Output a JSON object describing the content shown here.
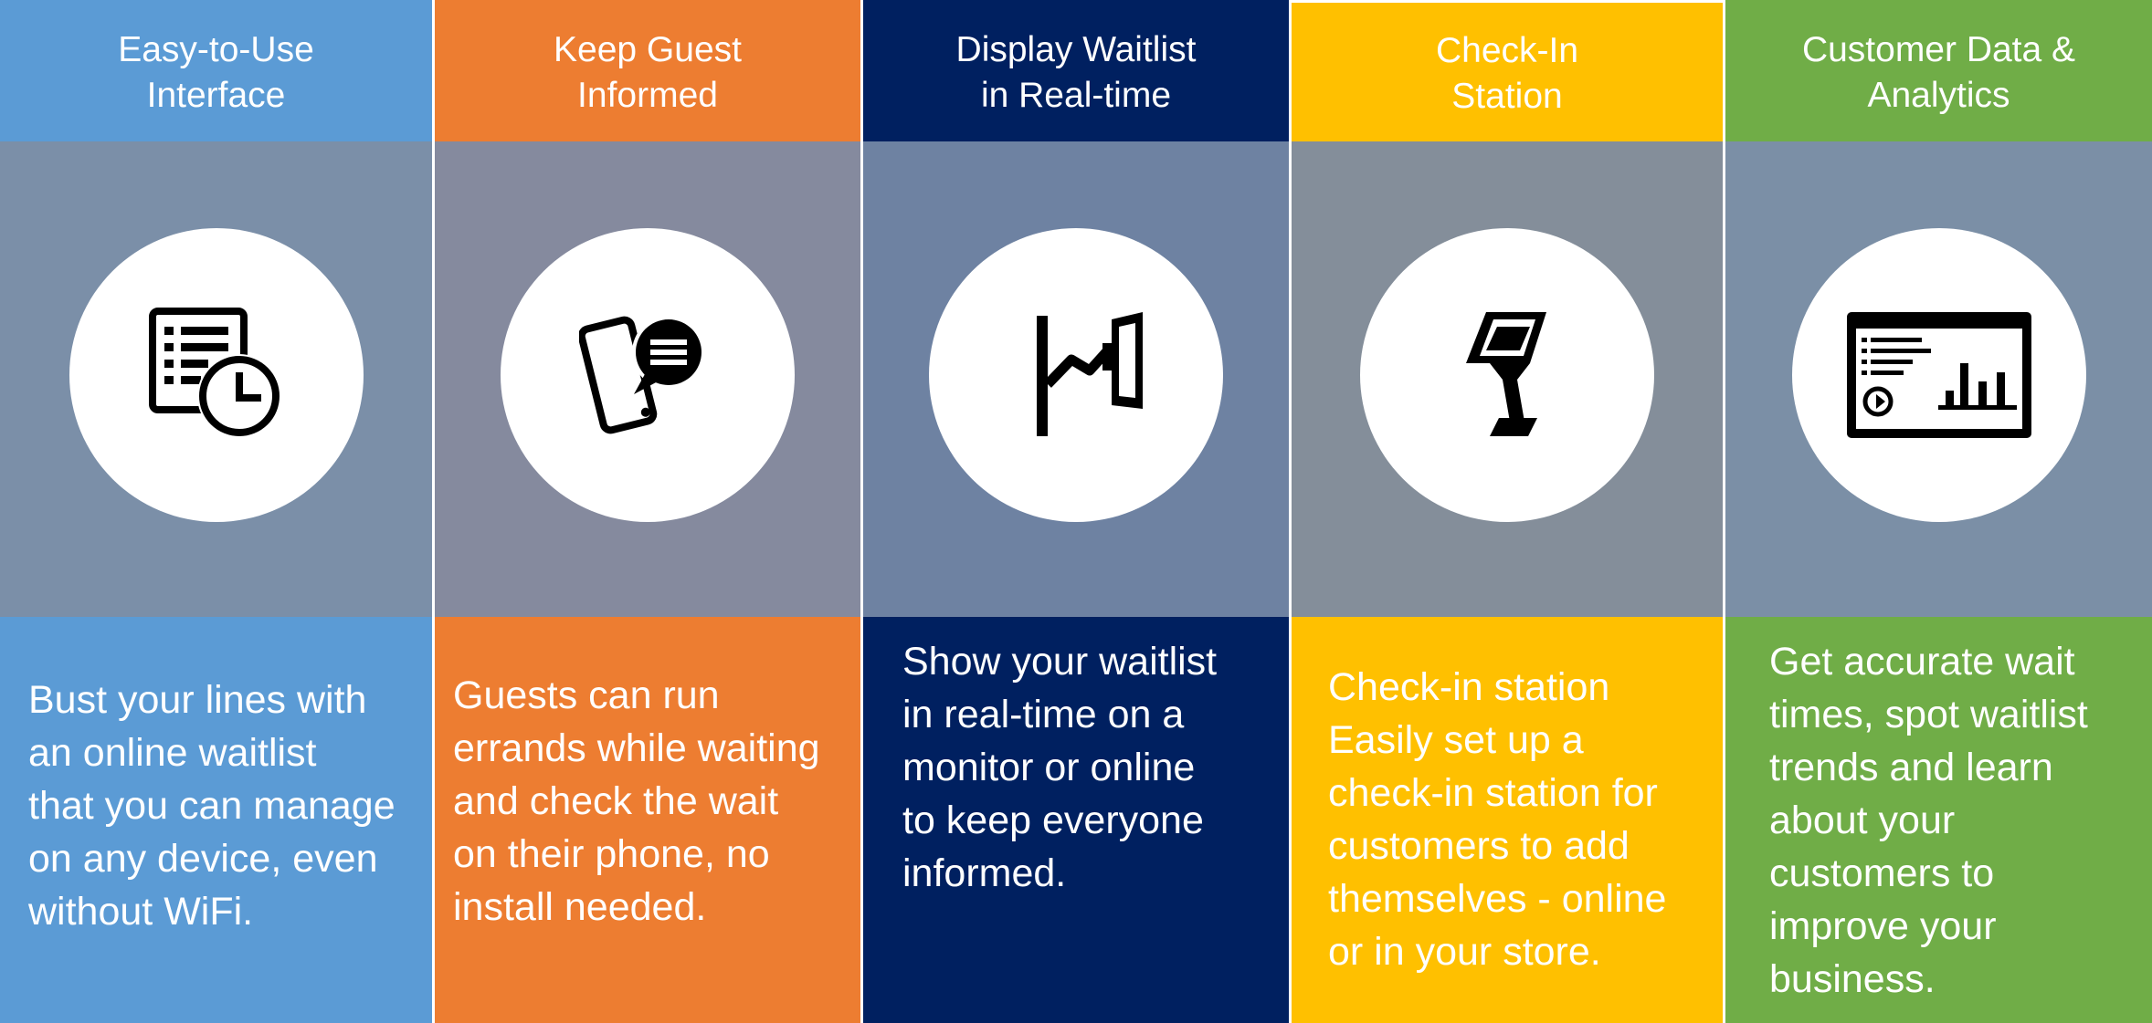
{
  "colors": {
    "blue": "#5B9BD5",
    "orange": "#ED7D31",
    "navy": "#002060",
    "gold": "#FFC000",
    "green": "#70AD47",
    "band_blue": "#7B8FA8",
    "band_orange": "#858A9E",
    "band_navy": "#6E82A2",
    "band_gold": "#848E9A",
    "band_green": "#7B8FA6"
  },
  "columns": [
    {
      "title": "Easy-to-Use\nInterface",
      "icon": "list-clock-icon",
      "text": "Bust your lines with\nan online waitlist\nthat you can manage\non any device, even\nwithout WiFi."
    },
    {
      "title": "Keep Guest\nInformed",
      "icon": "phone-chat-icon",
      "text": "Guests can run\nerrands while waiting\nand check the wait\non their phone, no\ninstall needed."
    },
    {
      "title": "Display Waitlist\nin Real-time",
      "icon": "wall-monitor-icon",
      "text": "Show your waitlist\nin real-time on a\nmonitor or online\nto keep everyone\ninformed."
    },
    {
      "title": "Check-In\nStation",
      "icon": "kiosk-icon",
      "text": "Check-in station\nEasily set up a\ncheck-in station for\ncustomers to add\nthemselves - online\nor in your store."
    },
    {
      "title": "Customer Data &\nAnalytics",
      "icon": "analytics-dashboard-icon",
      "text": "Get accurate wait\ntimes, spot waitlist\ntrends and learn\nabout your\ncustomers to\nimprove your\nbusiness."
    }
  ]
}
